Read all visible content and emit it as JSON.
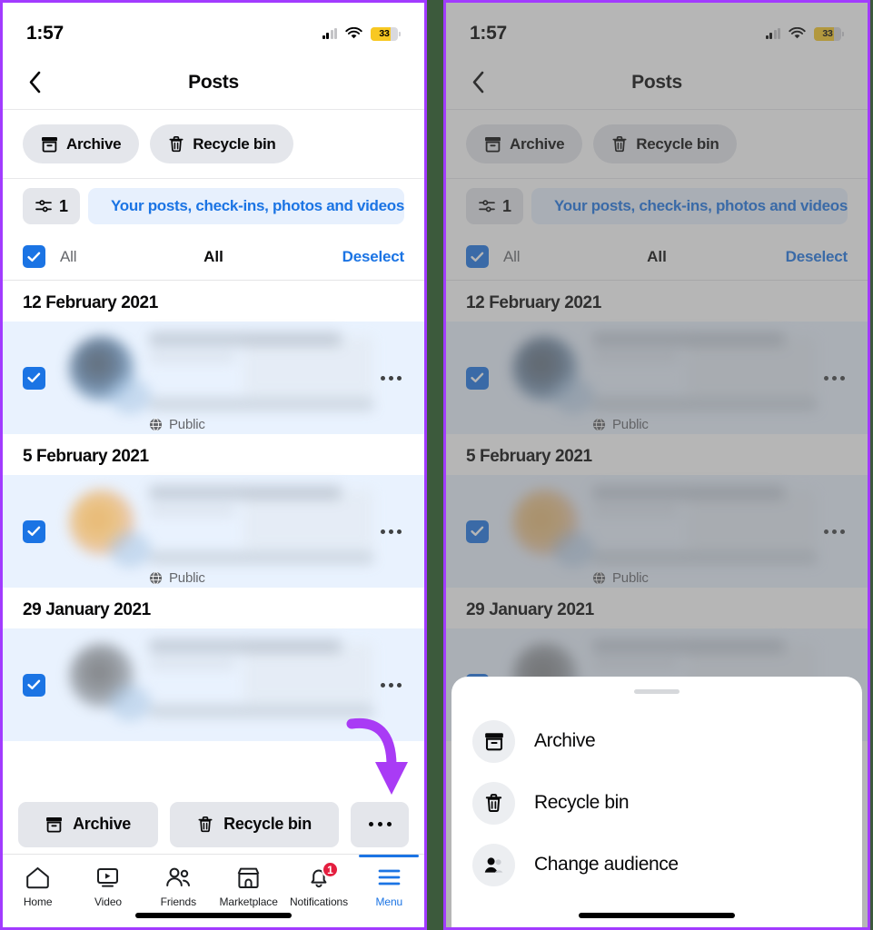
{
  "accent": {
    "blue": "#1b74e4",
    "arrow_purple": "#a93bf5",
    "badge_red": "#e41e3f",
    "battery_yellow": "#f8c822",
    "selected_row": "#e9f2fe",
    "pill_gray": "#e4e6eb"
  },
  "status_bar": {
    "time": "1:57",
    "battery_percent": "33",
    "signal_icon": "cellular-signal-icon",
    "wifi_icon": "wifi-icon",
    "battery_icon": "battery-low-power-icon"
  },
  "nav": {
    "back_icon": "back-chevron-icon",
    "title": "Posts"
  },
  "toolbar_pills": [
    {
      "label": "Archive",
      "icon": "archive-box-icon"
    },
    {
      "label": "Recycle bin",
      "icon": "trash-can-icon"
    }
  ],
  "filter_row": {
    "count": "1",
    "filter_icon": "filter-sliders-icon",
    "chip_close_icon": "close-x-icon",
    "chip_label": "Your posts, check-ins, photos and videos"
  },
  "select_row": {
    "checkbox_checked": true,
    "left_label": "All",
    "center_label": "All",
    "right_action": "Deselect"
  },
  "posts": [
    {
      "date": "12 February 2021",
      "selected": true,
      "audience": "Public",
      "audience_icon": "globe-icon",
      "kebab_icon": "more-horizontal-icon",
      "avatar_tone": "a1"
    },
    {
      "date": "5 February 2021",
      "selected": true,
      "audience": "Public",
      "audience_icon": "globe-icon",
      "kebab_icon": "more-horizontal-icon",
      "avatar_tone": "a2"
    },
    {
      "date": "29 January 2021",
      "selected": true,
      "audience": "",
      "audience_icon": "globe-icon",
      "kebab_icon": "more-horizontal-icon",
      "avatar_tone": "a3"
    }
  ],
  "action_bar": [
    {
      "label": "Archive",
      "icon": "archive-box-icon"
    },
    {
      "label": "Recycle bin",
      "icon": "trash-can-icon"
    },
    {
      "label": "",
      "icon": "more-horizontal-icon"
    }
  ],
  "tab_bar": [
    {
      "label": "Home",
      "icon": "home-icon",
      "active": false,
      "badge": ""
    },
    {
      "label": "Video",
      "icon": "video-play-icon",
      "active": false,
      "badge": ""
    },
    {
      "label": "Friends",
      "icon": "friends-people-icon",
      "active": false,
      "badge": ""
    },
    {
      "label": "Marketplace",
      "icon": "marketplace-store-icon",
      "active": false,
      "badge": ""
    },
    {
      "label": "Notifications",
      "icon": "bell-icon",
      "active": false,
      "badge": "1"
    },
    {
      "label": "Menu",
      "icon": "hamburger-menu-icon",
      "active": true,
      "badge": ""
    }
  ],
  "bottom_sheet": {
    "grabber": "sheet-grabber",
    "items": [
      {
        "label": "Archive",
        "icon": "archive-box-icon"
      },
      {
        "label": "Recycle bin",
        "icon": "trash-can-icon"
      },
      {
        "label": "Change audience",
        "icon": "audience-people-icon"
      }
    ]
  },
  "annotations": [
    {
      "name": "arrow-to-more-button",
      "shape": "curved-down-arrow",
      "color": "#a93bf5"
    },
    {
      "name": "arrow-to-change-audience",
      "shape": "curved-left-arrow",
      "color": "#a93bf5"
    }
  ]
}
